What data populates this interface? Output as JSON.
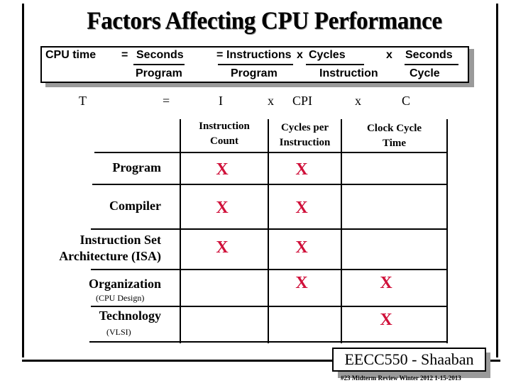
{
  "title": "Factors Affecting CPU Performance",
  "formula": {
    "lhs": "CPU time",
    "eq1": "=",
    "t1_num": "Seconds",
    "t1_den": "Program",
    "eq2": "=",
    "t2_num": "Instructions",
    "t2_den": "Program",
    "x1": "x",
    "t3_num": "Cycles",
    "t3_den": "Instruction",
    "x2": "x",
    "t4_num": "Seconds",
    "t4_den": "Cycle"
  },
  "short_formula": {
    "t": "T",
    "eq": "=",
    "i": "I",
    "x1": "x",
    "cpi": "CPI",
    "x2": "x",
    "c": "C"
  },
  "table": {
    "headers": [
      "Instruction Count",
      "Cycles per Instruction",
      "Clock Cycle Time"
    ],
    "header_lines": [
      [
        "Instruction",
        "Count"
      ],
      [
        "Cycles per",
        "Instruction"
      ],
      [
        "Clock Cycle",
        "Time"
      ]
    ],
    "mark_symbol": "X",
    "mark_color": "#d0103a",
    "rows": [
      {
        "label": "Program",
        "sub": "",
        "marks": [
          true,
          true,
          false
        ]
      },
      {
        "label": "Compiler",
        "sub": "",
        "marks": [
          true,
          true,
          false
        ]
      },
      {
        "label": "Instruction Set",
        "label2": "Architecture (ISA)",
        "sub": "",
        "marks": [
          true,
          true,
          false
        ]
      },
      {
        "label": "Organization",
        "sub": "(CPU Design)",
        "marks": [
          false,
          true,
          true
        ]
      },
      {
        "label": "Technology",
        "sub": "(VLSI)",
        "marks": [
          false,
          false,
          true
        ]
      }
    ]
  },
  "badge": "EECC550 - Shaaban",
  "footer": "#23   Midterm Review  Winter 2012  1-15-2013"
}
